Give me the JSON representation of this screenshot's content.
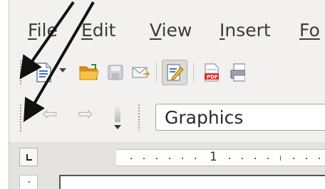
{
  "menubar": {
    "items": [
      {
        "key": "F",
        "rest": "ile"
      },
      {
        "key": "E",
        "rest": "dit"
      },
      {
        "key": "V",
        "rest": "iew"
      },
      {
        "key": "I",
        "rest": "nsert"
      },
      {
        "key": "Fo",
        "rest": ""
      }
    ]
  },
  "toolbar": {
    "icons": [
      "new-document-icon",
      "open-folder-icon",
      "save-icon",
      "email-document-icon",
      "edit-document-icon",
      "export-pdf-icon",
      "print-icon"
    ]
  },
  "drawing_toolbar": {
    "style_value": "Graphics"
  },
  "ruler": {
    "label": "1"
  },
  "colors": {
    "arrow": "#111111",
    "window_bg": "#f2f1f0",
    "pdf_red": "#d8312b",
    "folder_orange": "#f0a020"
  }
}
